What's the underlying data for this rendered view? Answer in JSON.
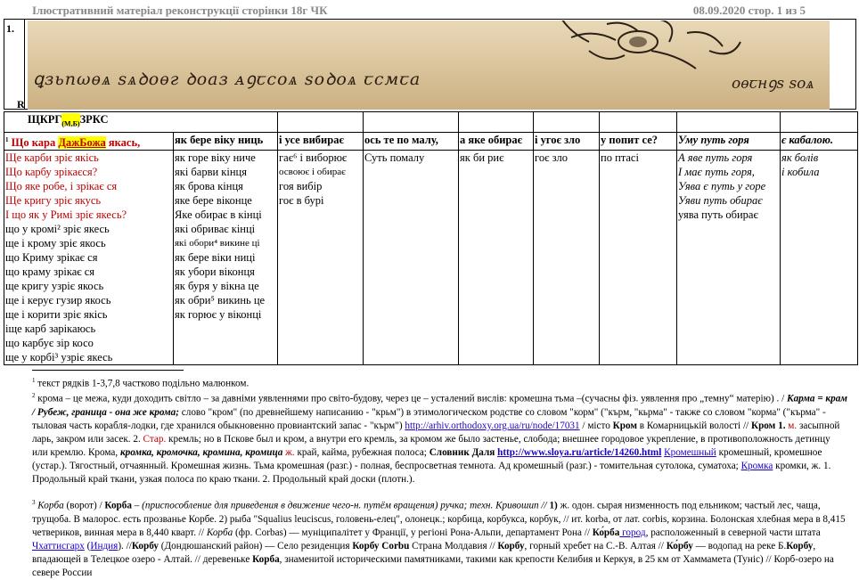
{
  "header": {
    "left": "Ілюстративний матеріал  реконструкції сторінки 18г  ЧК",
    "right": "08.09.2020  стор. 1 из 5"
  },
  "frame": {
    "number": "1.",
    "row_letter": "R"
  },
  "manuscript": {
    "line_text": "ꝗзьnωѳѧ ѕѧꝺоѳг ꝺоаз ᴀꝯꞇсоѧ ѕоꝺоѧ ꞇсмꞇа",
    "right_text": "оѳꞇнꝯѕ ѕоѧ"
  },
  "table": {
    "title": {
      "a": "ЩКРГ",
      "b": "(М,Б)",
      "c": "ЗРКС"
    },
    "header_row": {
      "c1_sup": "1",
      "c1_a": "Що кара ",
      "c1_b": "ДажБожа",
      "c1_c": " якась,",
      "c2": "як бере віку ниць",
      "c3": "і усе вибирає",
      "c4": "ось те по малу,",
      "c5": "а яке обирає",
      "c6": "і угоє зло",
      "c7": "у попит се?",
      "c8": "Уму путь горя",
      "c9": "є кабалою."
    },
    "col1": [
      "Ще карби зріє якісь",
      "Що карбу зрікаєся?",
      "Що яке робе, і зрікає ся",
      "Ще кригу зріє якусь",
      "І що як у Римі зріє якесь?",
      "що у кромі² зріє якесь",
      "ще і крому зріє якось",
      "що Криму зрікає ся",
      "що краму зрікає ся",
      "ще кригу узріє якось",
      "ще і керує гузир якось",
      "ще і корити зріє якісь",
      "іще карб зарікаюсь",
      "що карбує зір косо",
      "ще у корбі³ узріє якесь"
    ],
    "col2": [
      "як горе віку ниче",
      "які барви кінця",
      "як брова кінця",
      "яке бере віконце",
      "Яке обирає в кінці",
      "які обриває кінці",
      "які обори⁴ викине ці",
      "як бере віки ниці",
      "як убори віконця",
      "як буря у вікна це",
      "як обри⁵ викинь це",
      "як горює у віконці"
    ],
    "col3": [
      "гає⁶ і виборює",
      "освоює і обирає",
      "гоя вибір",
      "гоє в бурі"
    ],
    "col4": [
      "Суть помалу"
    ],
    "col5": [
      "як би риє"
    ],
    "col6": [
      "гоє зло"
    ],
    "col7": [
      "по птасі"
    ],
    "col8": [
      "А яве путь горя",
      "І має путь горя,",
      "Уява є путь у горе",
      "Уяви путь обирає",
      "уява путь обирає"
    ],
    "col9": [
      "як болів",
      "і кобила"
    ]
  },
  "footnotes": {
    "f1": "текст  рядків 1-3,7,8 частково подільно малюнком.",
    "f2_a": "  крома – це межа, куди доходить світло – за давніми уявленнями про світо-будову, через це – усталений вислів: кромешна тьма –(сучасны фіз. уявлення про „темну“ матерію) . / ",
    "f2_b": "Карма = крам / Рубеж, граница - она же крома;",
    "f2_c": " слово \"кром\" (по древнейшему написанию - \"крьм\") в этимологическом родстве со словом \"корм\" (\"кърм, \"кьрма\" - также со словом \"корма\" (\"кърма\" - тыловая часть корабля-лодки, где хранился обыкновенно провиантский запас - \"кърм\")",
    "f2_link1": "http://arhiv.orthodoxy.org.ua/ru/node/17031",
    "f2_d": "  / місто ",
    "f2_e": "Кром",
    "f2_f": " в Комарницькій волості // ",
    "f2_g": "Кром 1.",
    "f2_h": " м.",
    "f2_i": " засыпной ларь, закром или засек. 2.  ",
    "f2_j": "Стар.",
    "f2_k": " кремль; но в Пскове был и кром, а внутри его кремль, за кромом же было застенье, слобода; внешнее городовое укрепление, в противоположность детинцу или кремлю. Крома, ",
    "f2_l": "кромка, кромочка, кромина, кромица",
    "f2_m": " ж.",
    "f2_n": " край, кайма, рубежная полоса;  ",
    "f2_o": "Словник Даля",
    "f2_link2": "http://www.sloya.ru/article/14260.html",
    "f2_p": "  ",
    "f2_q": "Кромешный",
    "f2_r": " кромешный, кромешное (устар.). Тягостный, отчаянный. Кромешная жизнь. Тьма кромешная (разг.) - полная, беспросветная темнота. Ад кромешный (разг.) - томительная сутолока, суматоха; ",
    "f2_s": "Кромка",
    "f2_t": " кромки, ж. 1. Продольный край ткани, узкая полоса по краю ткани. 2. Продольный край доски (плотн.).",
    "f3_a": " Корба",
    "f3_b": " (ворот) / ",
    "f3_c": "Корба",
    "f3_d": " – (приспособление для приведения в движение чего-н. путём вращения) ручка; техн. Кривошип // ",
    "f3_e": "1)",
    "f3_f": " ж. одон. сырая низменность под ельником; частый лес, чаща, трущоба. В малорос. есть прозванье Корбе. 2) рыба \"Squalius leuciscus, головень-елец\", олонецк.; корбица, корбукса, корбук,  // ит. korba, от лат. corbis, корзина. Болонская хлебная мера в 8,415 четвериков, винная мера в 8,440 кварт. // ",
    "f3_g": "Корба",
    "f3_h": " (фр. Corbas) — муніципалітет у Франції, у регіоні Рона-Альпи, департамент Рона // ",
    "f3_i": "Ко́рба",
    "f3_j": " город",
    "f3_k": ", расположенный в северной части штата ",
    "f3_l": "Чхаттисгарх",
    "f3_m": " (",
    "f3_n": "Индия",
    "f3_o": "). //",
    "f3_p": "Корбу",
    "f3_q": " (Дондюшанский район) — Село резиденция ",
    "f3_r": "Корбу Corbu",
    "f3_s": " Страна Молдавия // ",
    "f3_t": "Корбу",
    "f3_u": ", горный хребет на С.-В. Алтая // ",
    "f3_v": "Ко́рбу",
    "f3_w": " — водопад на реке Б.",
    "f3_x": "Корбу",
    "f3_y": ", впадающей в Телецкое озеро - Алтай. // деревеньке ",
    "f3_z": "Корба",
    "f3_z2": ", знаменитой историческими памятниками, такими как крепости Келибия и Керкуя, в 25 км от Хаммамета (Туніс) // Корб-озеро на севере России"
  }
}
